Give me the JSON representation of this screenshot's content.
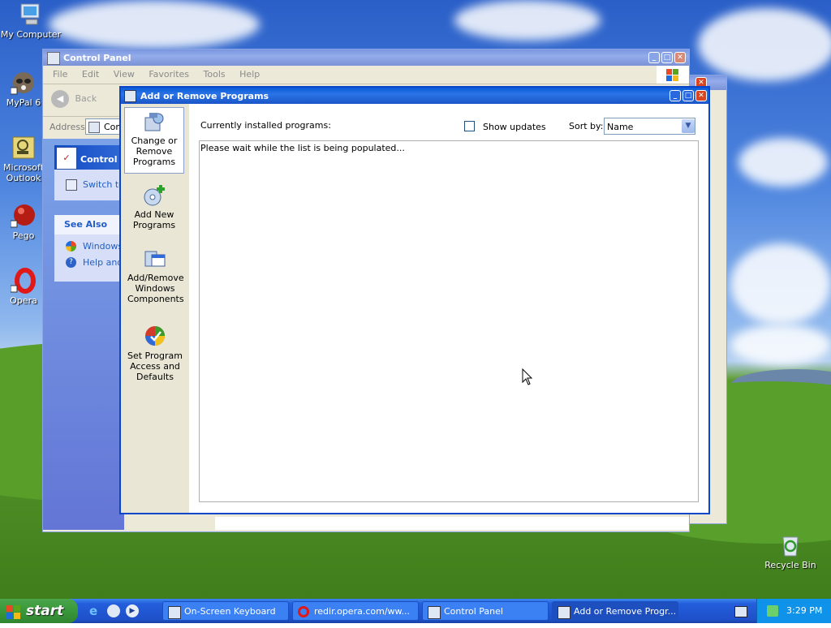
{
  "desktop_icons": [
    {
      "label": "My Computer"
    },
    {
      "label": "MyPal 6"
    },
    {
      "label": "Microsoft Outlook"
    },
    {
      "label": "Pego"
    },
    {
      "label": "Opera"
    },
    {
      "label": "Recycle Bin"
    }
  ],
  "control_panel": {
    "title": "Control Panel",
    "menu": [
      "File",
      "Edit",
      "View",
      "Favorites",
      "Tools",
      "Help"
    ],
    "back_label": "Back",
    "address_label": "Address",
    "address_value": "Cont",
    "task_title": "Control P",
    "switch_label": "Switch to",
    "see_also": "See Also",
    "see_also_items": [
      "Windows",
      "Help and"
    ]
  },
  "arp": {
    "title": "Add or Remove Programs",
    "sidebar": [
      {
        "label": "Change or Remove Programs"
      },
      {
        "label": "Add New Programs"
      },
      {
        "label": "Add/Remove Windows Components"
      },
      {
        "label": "Set Program Access and Defaults"
      }
    ],
    "installed_label": "Currently installed programs:",
    "show_updates_label": "Show updates",
    "sort_by_label": "Sort by:",
    "sort_by_value": "Name",
    "list_message": "Please wait while the list is being populated..."
  },
  "taskbar": {
    "start_label": "start",
    "tasks": [
      {
        "label": "On-Screen Keyboard"
      },
      {
        "label": "redir.opera.com/ww..."
      },
      {
        "label": "Control Panel"
      },
      {
        "label": "Add or Remove Progr..."
      }
    ],
    "clock": "3:29 PM"
  },
  "colors": {
    "xp_blue": "#0a5bd8",
    "close_red": "#d8451f",
    "start_green": "#3c9a3c"
  }
}
